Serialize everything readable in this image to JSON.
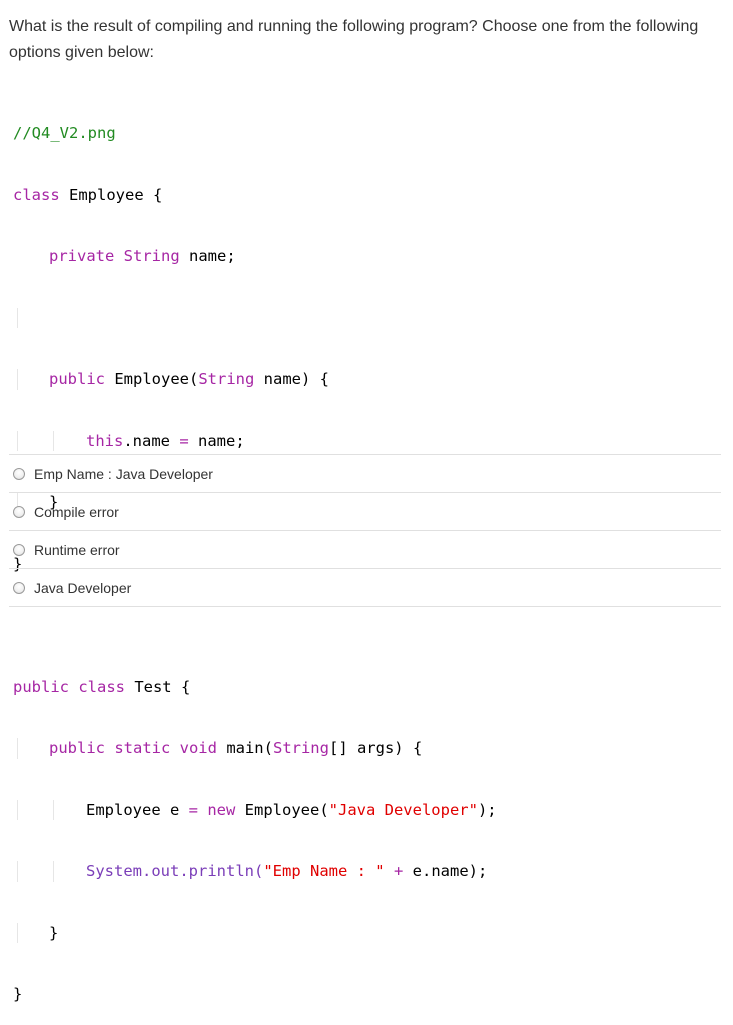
{
  "question": {
    "text": "What is the result of compiling and running the following program? Choose one from the following options given below:"
  },
  "code": {
    "comment": "//Q4_V2.png",
    "class_kw": "class",
    "class_name": " Employee {",
    "private_kw": "private",
    "string_type": "String",
    "field_rest": " name;",
    "public_kw": "public",
    "ctor_name": " Employee(",
    "ctor_string": "String",
    "ctor_rest": " name) {",
    "this_kw": "this",
    "this_rest": ".name ",
    "assign_op": "=",
    "assign_rest": " name;",
    "close_brace": "}",
    "public_class": "public class",
    "test_name": " Test {",
    "main_mods": "public static void",
    "main_name": " main(",
    "main_string": "String",
    "main_rest": "[] args) {",
    "emp_decl": "Employee e ",
    "eq": "=",
    "new_kw": " new",
    "emp_ctor": " Employee(",
    "str_java": "\"Java Developer\"",
    "emp_end": ");",
    "system": "System",
    "println": ".out.println(",
    "str_emp": "\"Emp Name : \"",
    "plus": " +",
    "print_end": " e.name);"
  },
  "options": [
    {
      "label": "Emp Name : Java Developer"
    },
    {
      "label": "Compile error"
    },
    {
      "label": "Runtime error"
    },
    {
      "label": "Java Developer"
    }
  ]
}
